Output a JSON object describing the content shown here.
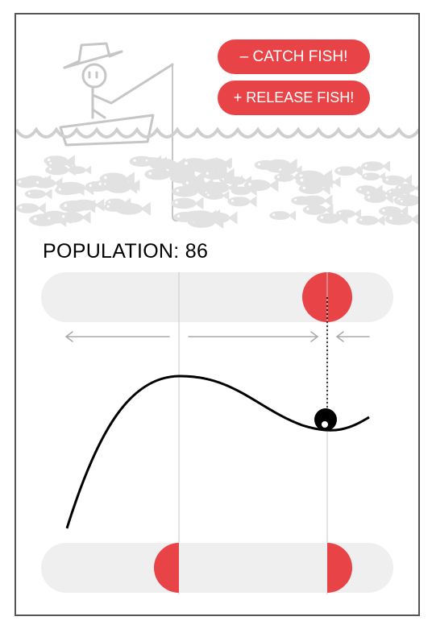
{
  "buttons": {
    "catch_label": "– CATCH FISH!",
    "release_label": "+ RELEASE FISH!"
  },
  "population": {
    "label": "POPULATION: ",
    "value": 86
  },
  "colors": {
    "accent": "#e84447",
    "track": "#efefef",
    "sketch": "#c6c6c6",
    "curve": "#000000"
  },
  "icons": {
    "fisherman": "fisherman-icon",
    "waves": "waves-icon",
    "fish": "fish-icon",
    "hook": "hook-icon"
  }
}
